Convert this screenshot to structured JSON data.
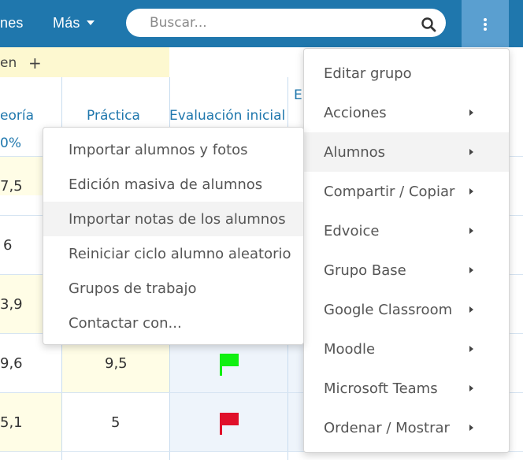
{
  "topbar": {
    "nav_partial": "nes",
    "nav_mas": "Más",
    "search_placeholder": "Buscar..."
  },
  "grid": {
    "header_partial": "en",
    "add_symbol": "+",
    "col_teoria": "eoría",
    "col_teoria_pct": "0%",
    "col_practica": "Práctica",
    "col_eval_inicial": "Evaluación inicial",
    "col_partial_e": "E",
    "rows": [
      {
        "teoria": "7,5",
        "practica": ""
      },
      {
        "teoria": "6",
        "practica": ""
      },
      {
        "teoria": "3,9",
        "practica": ""
      },
      {
        "teoria": "9,6",
        "practica": "9,5"
      },
      {
        "teoria": "5,1",
        "practica": "5"
      }
    ],
    "flag_colors": {
      "green": "#10f010",
      "red": "#e0102a"
    }
  },
  "main_menu": {
    "items": [
      {
        "label": "Editar grupo",
        "submenu": false
      },
      {
        "label": "Acciones",
        "submenu": true
      },
      {
        "label": "Alumnos",
        "submenu": true,
        "active": true
      },
      {
        "label": "Compartir / Copiar",
        "submenu": true
      },
      {
        "label": "Edvoice",
        "submenu": true
      },
      {
        "label": "Grupo Base",
        "submenu": true
      },
      {
        "label": "Google Classroom",
        "submenu": true
      },
      {
        "label": "Moodle",
        "submenu": true
      },
      {
        "label": "Microsoft Teams",
        "submenu": true
      },
      {
        "label": "Ordenar / Mostrar",
        "submenu": true
      }
    ]
  },
  "sub_menu": {
    "items": [
      {
        "label": "Importar alumnos y fotos"
      },
      {
        "label": "Edición masiva de alumnos"
      },
      {
        "label": "Importar notas de los alumnos",
        "active": true
      },
      {
        "label": "Reiniciar ciclo alumno aleatorio"
      },
      {
        "label": "Grupos de trabajo"
      },
      {
        "label": "Contactar con..."
      }
    ]
  }
}
